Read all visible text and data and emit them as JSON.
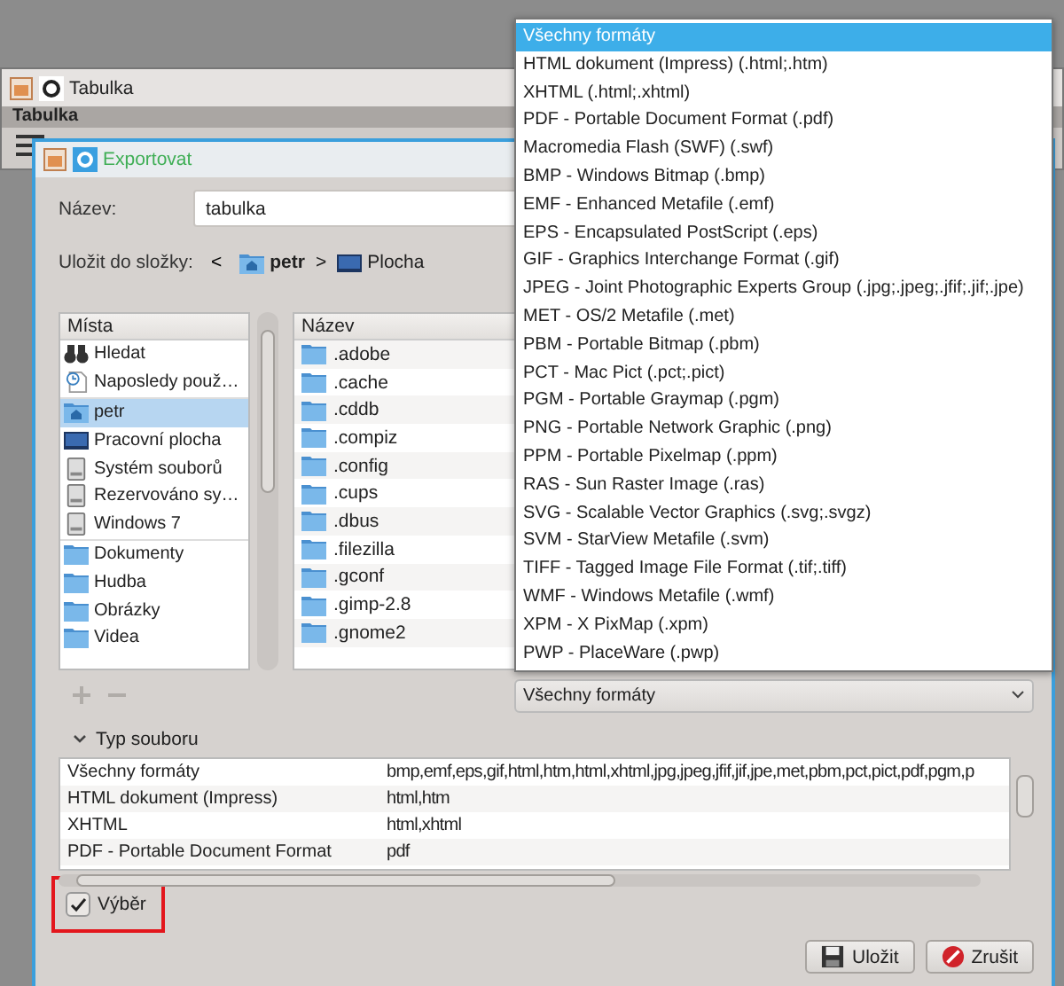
{
  "back_window": {
    "title": "Tabulka",
    "menu_title": "Tabulka"
  },
  "dialog": {
    "title": "Exportovat"
  },
  "name_field": {
    "label": "Název:",
    "value": "tabulka"
  },
  "folder": {
    "label": "Uložit do složky:",
    "back": "<",
    "separator": ">",
    "path": [
      {
        "label": "petr",
        "kind": "home",
        "emphasized": true
      },
      {
        "label": "Plocha",
        "kind": "desktop",
        "emphasized": false
      }
    ]
  },
  "places": {
    "header": "Místa",
    "items": [
      {
        "label": "Hledat",
        "kind": "search",
        "selected": false,
        "separator_before": false
      },
      {
        "label": "Naposledy použ…",
        "kind": "recent",
        "selected": false,
        "separator_before": false
      },
      {
        "label": "petr",
        "kind": "home",
        "selected": true,
        "separator_before": true
      },
      {
        "label": "Pracovní plocha",
        "kind": "desktop",
        "selected": false,
        "separator_before": false
      },
      {
        "label": "Systém souborů",
        "kind": "drive",
        "selected": false,
        "separator_before": false
      },
      {
        "label": "Rezervováno sy…",
        "kind": "drive",
        "selected": false,
        "separator_before": false
      },
      {
        "label": "Windows 7",
        "kind": "drive",
        "selected": false,
        "separator_before": false
      },
      {
        "label": "Dokumenty",
        "kind": "folder",
        "selected": false,
        "separator_before": true
      },
      {
        "label": "Hudba",
        "kind": "folder",
        "selected": false,
        "separator_before": false
      },
      {
        "label": "Obrázky",
        "kind": "folder",
        "selected": false,
        "separator_before": false
      },
      {
        "label": "Videa",
        "kind": "folder",
        "selected": false,
        "separator_before": false
      }
    ]
  },
  "files": {
    "header": "Název",
    "items": [
      ".adobe",
      ".cache",
      ".cddb",
      ".compiz",
      ".config",
      ".cups",
      ".dbus",
      ".filezilla",
      ".gconf",
      ".gimp-2.8",
      ".gnome2"
    ]
  },
  "format_popup": {
    "items": [
      {
        "label": "Všechny formáty",
        "selected": true
      },
      {
        "label": "HTML dokument (Impress) (.html;.htm)",
        "selected": false
      },
      {
        "label": "XHTML (.html;.xhtml)",
        "selected": false
      },
      {
        "label": "PDF - Portable Document Format (.pdf)",
        "selected": false
      },
      {
        "label": "Macromedia Flash (SWF) (.swf)",
        "selected": false
      },
      {
        "label": "BMP - Windows Bitmap (.bmp)",
        "selected": false
      },
      {
        "label": "EMF - Enhanced Metafile (.emf)",
        "selected": false
      },
      {
        "label": "EPS - Encapsulated PostScript (.eps)",
        "selected": false
      },
      {
        "label": "GIF - Graphics Interchange Format (.gif)",
        "selected": false
      },
      {
        "label": "JPEG - Joint Photographic Experts Group (.jpg;.jpeg;.jfif;.jif;.jpe)",
        "selected": false
      },
      {
        "label": "MET - OS/2 Metafile (.met)",
        "selected": false
      },
      {
        "label": "PBM - Portable Bitmap (.pbm)",
        "selected": false
      },
      {
        "label": "PCT - Mac Pict (.pct;.pict)",
        "selected": false
      },
      {
        "label": "PGM - Portable Graymap (.pgm)",
        "selected": false
      },
      {
        "label": "PNG - Portable Network Graphic (.png)",
        "selected": false
      },
      {
        "label": "PPM - Portable Pixelmap (.ppm)",
        "selected": false
      },
      {
        "label": "RAS - Sun Raster Image (.ras)",
        "selected": false
      },
      {
        "label": "SVG - Scalable Vector Graphics (.svg;.svgz)",
        "selected": false
      },
      {
        "label": "SVM - StarView Metafile (.svm)",
        "selected": false
      },
      {
        "label": "TIFF - Tagged Image File Format (.tif;.tiff)",
        "selected": false
      },
      {
        "label": "WMF - Windows Metafile (.wmf)",
        "selected": false
      },
      {
        "label": "XPM - X PixMap (.xpm)",
        "selected": false
      },
      {
        "label": "PWP - PlaceWare (.pwp)",
        "selected": false
      }
    ]
  },
  "format_combo": {
    "value": "Všechny formáty"
  },
  "file_types": {
    "title": "Typ souboru",
    "expanded": true,
    "rows": [
      {
        "name": "Všechny formáty",
        "extensions": "bmp,emf,eps,gif,html,htm,html,xhtml,jpg,jpeg,jfif,jif,jpe,met,pbm,pct,pict,pdf,pgm,p"
      },
      {
        "name": "HTML dokument (Impress)",
        "extensions": "html,htm"
      },
      {
        "name": "XHTML",
        "extensions": "html,xhtml"
      },
      {
        "name": "PDF - Portable Document Format",
        "extensions": "pdf"
      }
    ]
  },
  "selection_checkbox": {
    "label": "Výběr",
    "checked": true,
    "highlighted": true
  },
  "buttons": [
    {
      "label": "Uložit",
      "kind": "save"
    },
    {
      "label": "Zrušit",
      "kind": "cancel"
    }
  ]
}
